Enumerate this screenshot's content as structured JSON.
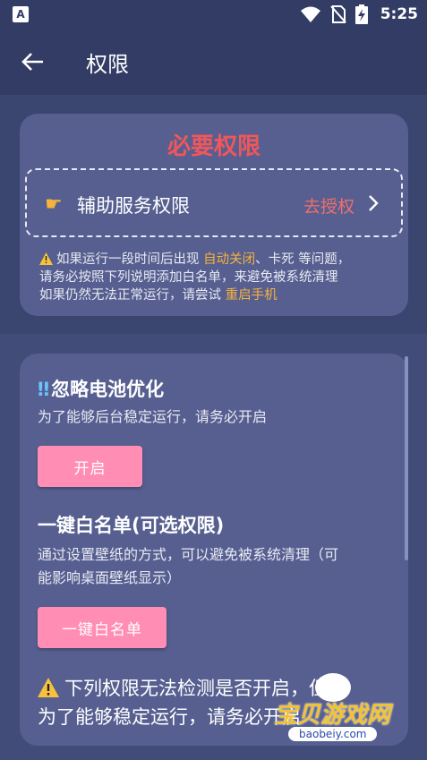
{
  "status_bar": {
    "app_icon_letter": "A",
    "time": "5:25"
  },
  "app_bar": {
    "title": "权限"
  },
  "required_section": {
    "title": "必要权限",
    "accessibility": {
      "label": "辅助服务权限",
      "action": "去授权"
    },
    "notice": {
      "line1_a": "如果运行一段时间后出现 ",
      "line1_hl": "自动关闭",
      "line1_b": "、卡死 等问题，",
      "line2": "请务必按照下列说明添加白名单，来避免被系统清理",
      "line3_a": "如果仍然无法正常运行，请尝试 ",
      "line3_hl": "重启手机"
    }
  },
  "optional_section": {
    "battery": {
      "bang": "‼",
      "title": "忽略电池优化",
      "desc": "为了能够后台稳定运行，请务必开启",
      "button": "开启"
    },
    "whitelist": {
      "title": "一键白名单(可选权限)",
      "desc_line1": "通过设置壁纸的方式，可以避免被系统清理（可",
      "desc_line2": "能影响桌面壁纸显示）",
      "button": "一键白名单"
    },
    "warning": {
      "line1": "下列权限无法检测是否开启，但是",
      "line2": "为了能够稳定运行，请务必开启"
    }
  },
  "watermark": {
    "text": "宝贝游戏网",
    "url": "baobeiy.com"
  },
  "colors": {
    "background": "#3a4570",
    "card": "#565f90",
    "required_title": "#f0575a",
    "highlight": "#f6b23c",
    "button": "#ff8db4",
    "grant": "#ef6f6c"
  }
}
